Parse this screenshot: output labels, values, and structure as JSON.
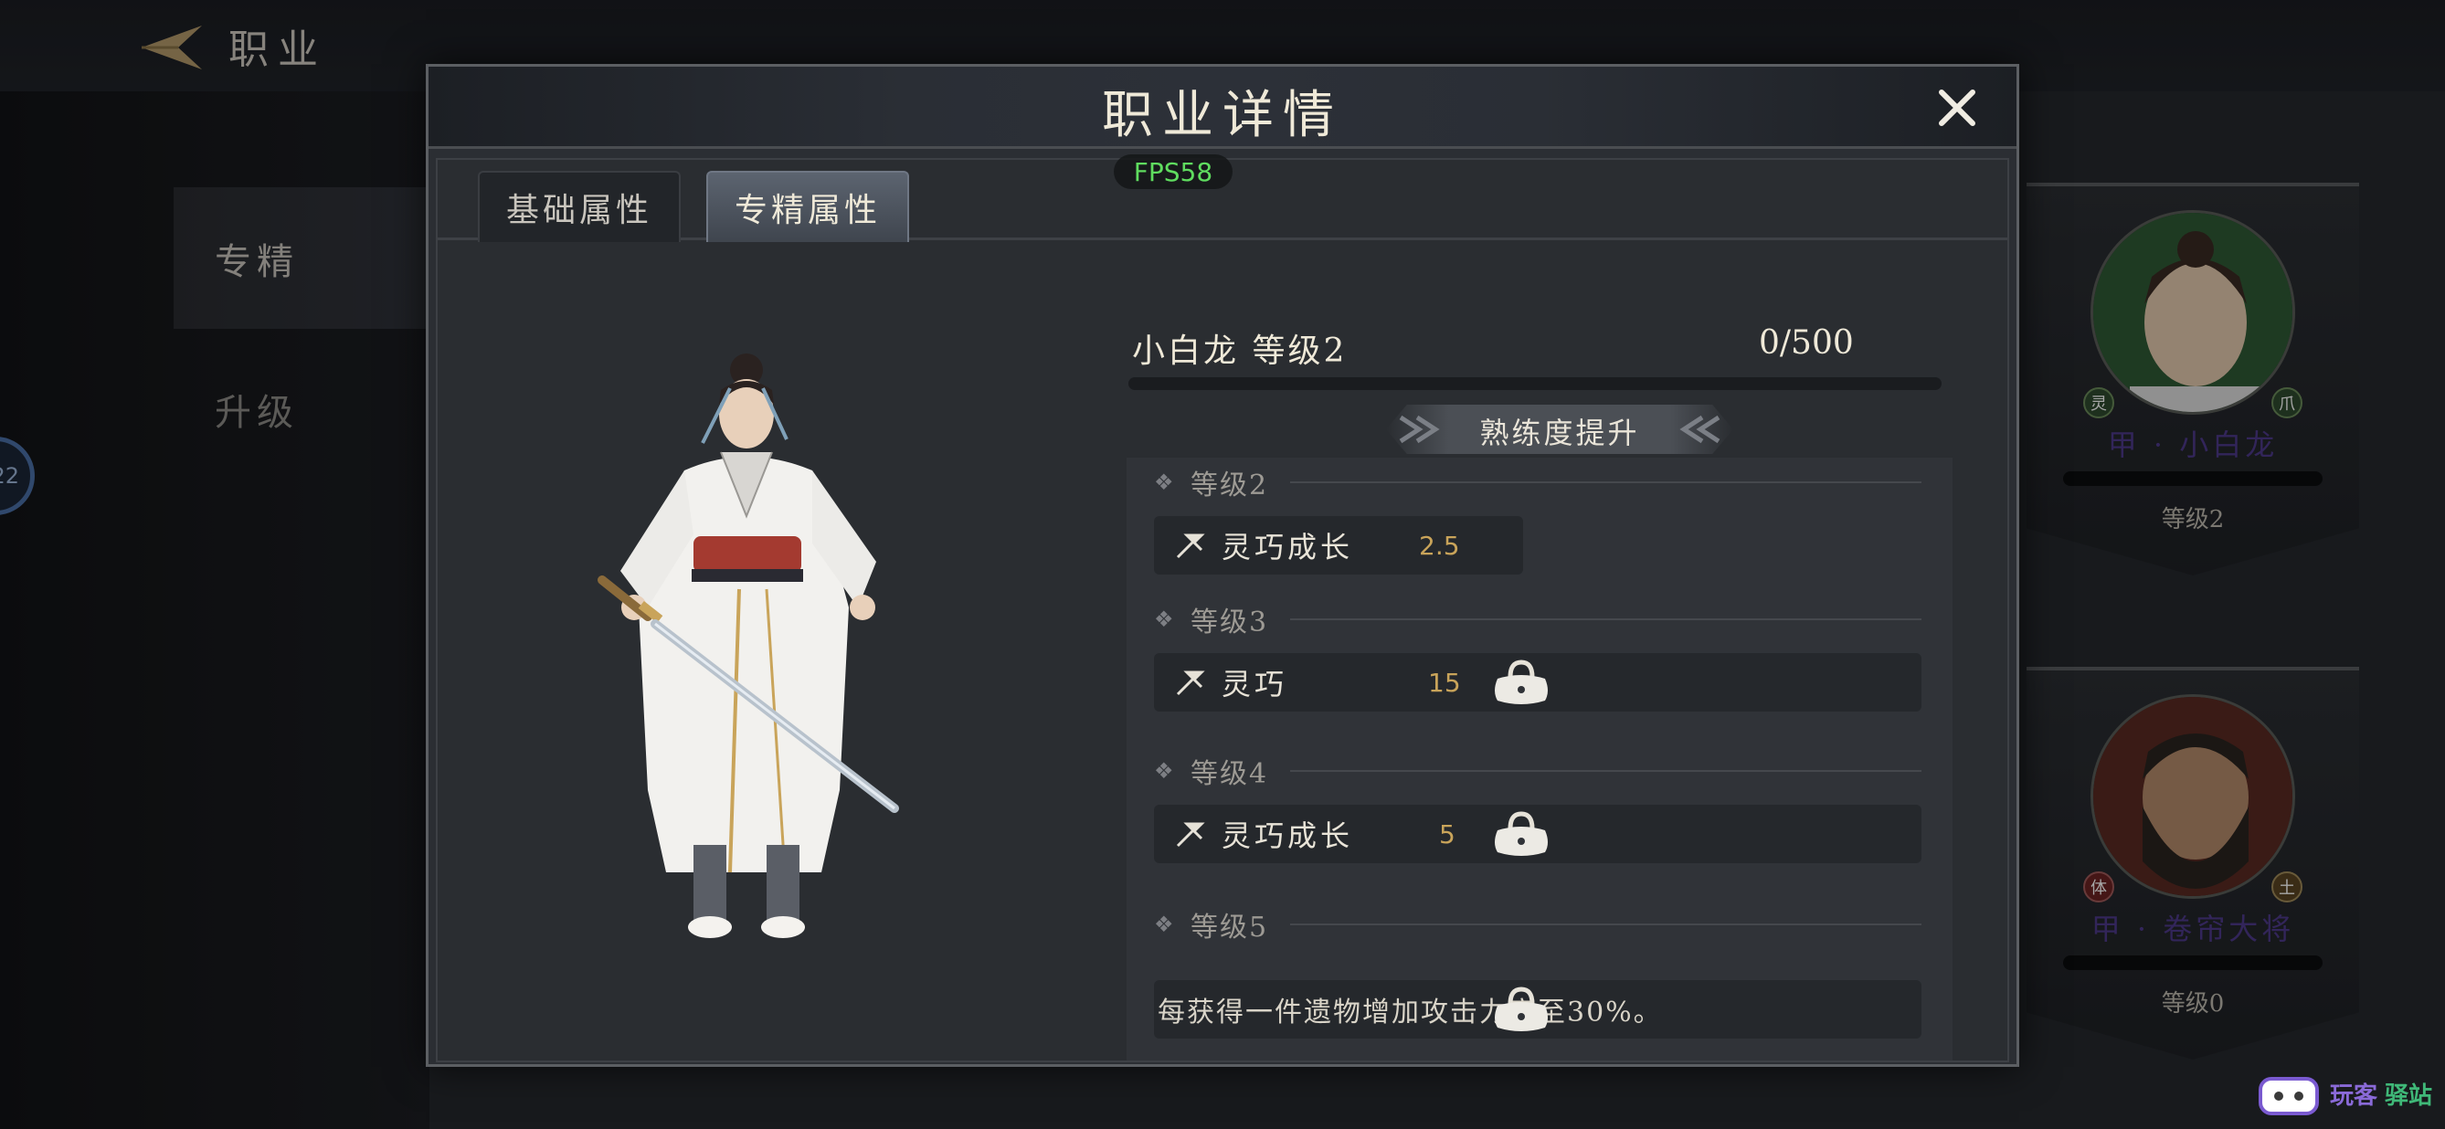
{
  "page": {
    "title": "职业"
  },
  "sidebar": {
    "items": [
      {
        "label": "专精",
        "active": true
      },
      {
        "label": "升级",
        "active": false
      }
    ],
    "badge": "22"
  },
  "cards": [
    {
      "name": "甲 · 小白龙",
      "level": "等级2",
      "tag_left": "灵",
      "tag_right": "爪"
    },
    {
      "name": "甲 · 卷帘大将",
      "level": "等级0",
      "tag_left": "体",
      "tag_right": "土"
    }
  ],
  "modal": {
    "title": "职业详情",
    "fps": "FPS58",
    "tabs": [
      {
        "label": "基础属性",
        "active": false
      },
      {
        "label": "专精属性",
        "active": true
      }
    ],
    "character": {
      "name_level": "小白龙  等级2",
      "exp": "0/500",
      "exp_fraction": 0
    },
    "proficiency_button": "熟练度提升",
    "levels": [
      {
        "label": "等级2",
        "stat_label": "灵巧成长",
        "stat_value": "2.5",
        "locked": false
      },
      {
        "label": "等级3",
        "stat_label": "灵巧",
        "stat_value": "15",
        "locked": true
      },
      {
        "label": "等级4",
        "stat_label": "灵巧成长",
        "stat_value": "5",
        "locked": true
      },
      {
        "label": "等级5",
        "desc": "每获得一件遗物增加攻击力高至30%。",
        "locked": true
      }
    ]
  },
  "colors": {
    "accent_gold": "#c9a45a",
    "card_name_purple": "#4e3a8a",
    "fps_green": "#5fdc5f"
  },
  "watermark": {
    "text_a": "玩客",
    "text_b": "驿站"
  }
}
